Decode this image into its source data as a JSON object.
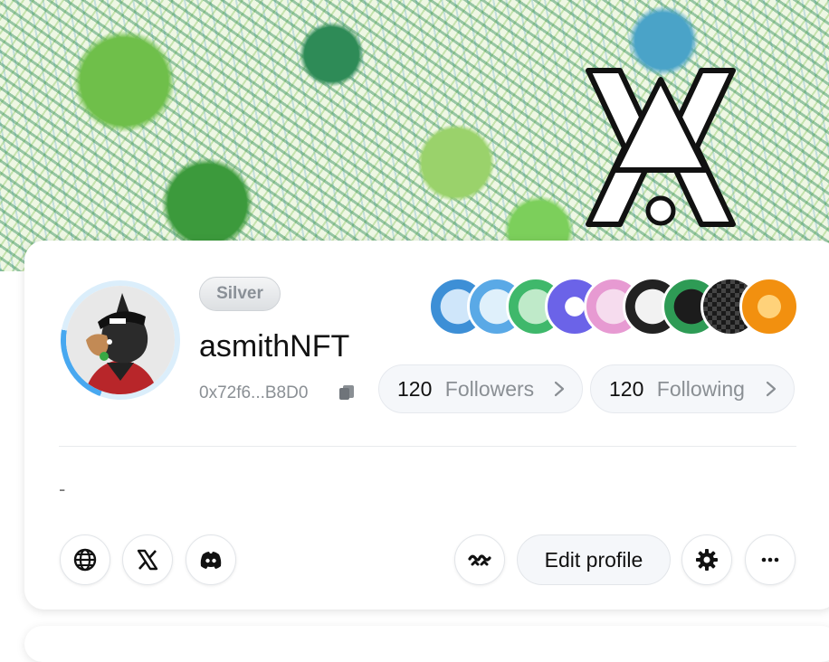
{
  "profile": {
    "tier": "Silver",
    "username": "asmithNFT",
    "address": "0x72f6...B8D0",
    "bio": "-"
  },
  "stats": {
    "followers_count": "120",
    "followers_label": "Followers",
    "following_count": "120",
    "following_label": "Following"
  },
  "badges": [
    {
      "name": "x-badge",
      "color": "#3d8fd6"
    },
    {
      "name": "ballot-badge",
      "color": "#5aa9e6"
    },
    {
      "name": "vote-badge",
      "color": "#3fb86b"
    },
    {
      "name": "discord-badge",
      "color": "#6b63e8"
    },
    {
      "name": "bottle-badge",
      "color": "#e79ad2"
    },
    {
      "name": "bridge-badge",
      "color": "#222222"
    },
    {
      "name": "pixel-avatar-badge",
      "color": "#2e9b55"
    },
    {
      "name": "checker-badge",
      "color": "#1a1a1a"
    },
    {
      "name": "bitcoin-badge",
      "color": "#f2900f"
    }
  ],
  "actions": {
    "edit_profile_label": "Edit profile"
  },
  "icons": {
    "website": "globe-icon",
    "x": "x-logo-icon",
    "discord": "discord-icon",
    "wallet": "wave-icon",
    "settings": "gear-icon",
    "more": "more-dots-icon",
    "copy": "copy-icon"
  },
  "colors": {
    "accent_blue": "#48a8f0",
    "banner_green": "#2e8b57"
  }
}
